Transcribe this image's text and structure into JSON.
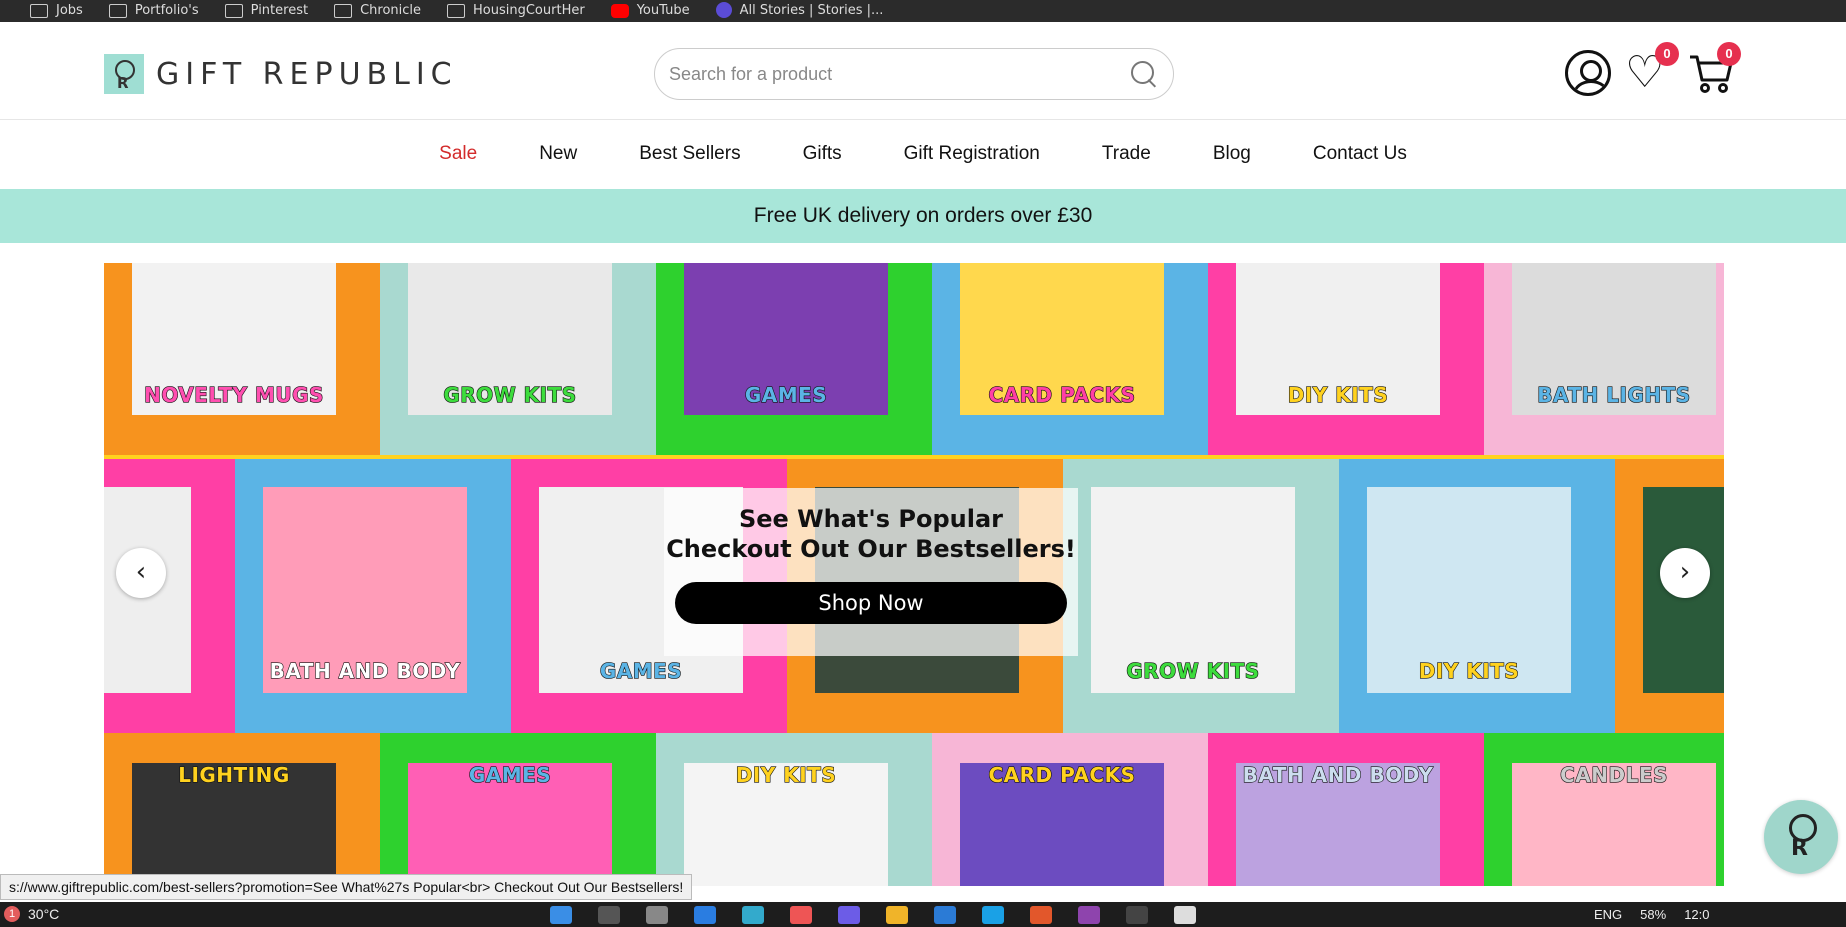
{
  "bookmarks": [
    {
      "label": "Jobs",
      "icon": "folder-icon"
    },
    {
      "label": "Portfolio's",
      "icon": "folder-icon"
    },
    {
      "label": "Pinterest",
      "icon": "folder-icon"
    },
    {
      "label": "Chronicle",
      "icon": "folder-icon"
    },
    {
      "label": "HousingCourtHer",
      "icon": "folder-icon"
    },
    {
      "label": "YouTube",
      "icon": "youtube-icon"
    },
    {
      "label": "All Stories | Stories |...",
      "icon": "stories-icon"
    }
  ],
  "header": {
    "logo_text": "GIFT REPUBLIC",
    "search_placeholder": "Search for a product",
    "wishlist_count": "0",
    "cart_count": "0"
  },
  "nav": {
    "items": [
      "Sale",
      "New",
      "Best Sellers",
      "Gifts",
      "Gift Registration",
      "Trade",
      "Blog",
      "Contact Us"
    ]
  },
  "promo": {
    "text": "Free UK delivery on orders over £30"
  },
  "hero": {
    "cta_line1": "See What's Popular",
    "cta_line2": "Checkout Out Our Bestsellers!",
    "cta_button": "Shop Now",
    "row1": [
      "NOVELTY MUGS",
      "GROW KITS",
      "GAMES",
      "CARD PACKS",
      "DIY KITS",
      "BATH LIGHTS"
    ],
    "row2": [
      "",
      "BATH AND BODY",
      "GAMES",
      "",
      "GROW KITS",
      "DIY KITS",
      ""
    ],
    "row3": [
      "LIGHTING",
      "GAMES",
      "DIY KITS",
      "CARD PACKS",
      "BATH AND BODY",
      "CANDLES"
    ],
    "colors": {
      "orange": "#f7931e",
      "teal": "#a9d9d0",
      "green": "#2ed12e",
      "blue": "#5bb4e5",
      "pink": "#ff3fa5",
      "lightpink": "#f7b6d6",
      "yellow": "#ffd21f"
    }
  },
  "status_url": "s://www.giftrepublic.com/best-sellers?promotion=See What%27s Popular<br> Checkout Out Our Bestsellers!",
  "taskbar": {
    "notification_count": "1",
    "temperature": "30°C",
    "language": "ENG",
    "battery": "58%",
    "clock": "12:0"
  }
}
